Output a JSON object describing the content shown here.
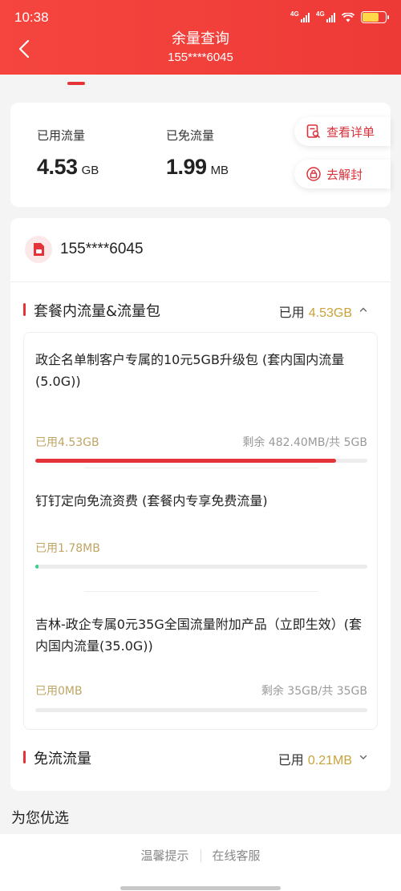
{
  "status_bar": {
    "time": "10:38",
    "signal1_label": "4G",
    "signal2_label": "4G"
  },
  "header": {
    "title": "余量查询",
    "subtitle": "155****6045",
    "back_icon": "chevron-left-icon"
  },
  "summary": {
    "used": {
      "label": "已用流量",
      "value": "4.53",
      "unit": "GB"
    },
    "free": {
      "label": "已免流量",
      "value": "1.99",
      "unit": "MB"
    },
    "details_button": "查看详单",
    "unlock_button": "去解封"
  },
  "account": {
    "phone": "155****6045",
    "icon": "sim-card-icon"
  },
  "sections": [
    {
      "name": "套餐内流量&流量包",
      "used_prefix": "已用",
      "used_value": "4.53GB",
      "expanded": true
    },
    {
      "name": "免流流量",
      "used_prefix": "已用",
      "used_value": "0.21MB",
      "expanded": false
    }
  ],
  "packages": [
    {
      "name": "政企名单制客户专属的10元5GB升级包 (套内国内流量(5.0G))",
      "used_label": "已用4.53GB",
      "remaining_label": "剩余 482.40MB/共 5GB",
      "progress": 0.906,
      "bar_color": "#e5333a"
    },
    {
      "name": "钉钉定向免流资费 (套餐内专享免费流量)",
      "used_label": "已用1.78MB",
      "remaining_label": "",
      "progress": 0.01,
      "bar_color": "#3ccf8e"
    },
    {
      "name": "吉林-政企专属0元35G全国流量附加产品（立即生效）(套内国内流量(35.0G))",
      "used_label": "已用0MB",
      "remaining_label": "剩余 35GB/共 35GB",
      "progress": 0,
      "bar_color": "#e5333a"
    }
  ],
  "recommend_title": "为您优选",
  "footer": {
    "tip_link": "温馨提示",
    "service_link": "在线客服"
  },
  "colors": {
    "brand_red": "#ee3a37",
    "accent_gold": "#c9a23a"
  }
}
